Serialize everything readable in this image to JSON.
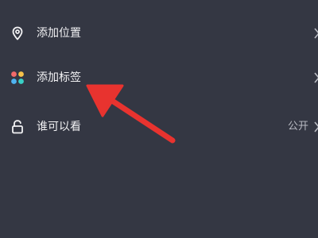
{
  "rows": {
    "location": {
      "label": "添加位置",
      "icon": "location-pin-icon"
    },
    "tag": {
      "label": "添加标签",
      "icon": "colored-dots-icon"
    },
    "privacy": {
      "label": "谁可以看",
      "value": "公开",
      "icon": "unlock-icon"
    }
  },
  "colors": {
    "background": "#343743",
    "text": "#f2f2f4",
    "secondary_text": "#b8bac2",
    "annotation_arrow": "#e8332f",
    "tag_dot_colors": [
      "#f36a6a",
      "#f6c14a",
      "#4fb4f2",
      "#39d0c6"
    ]
  }
}
